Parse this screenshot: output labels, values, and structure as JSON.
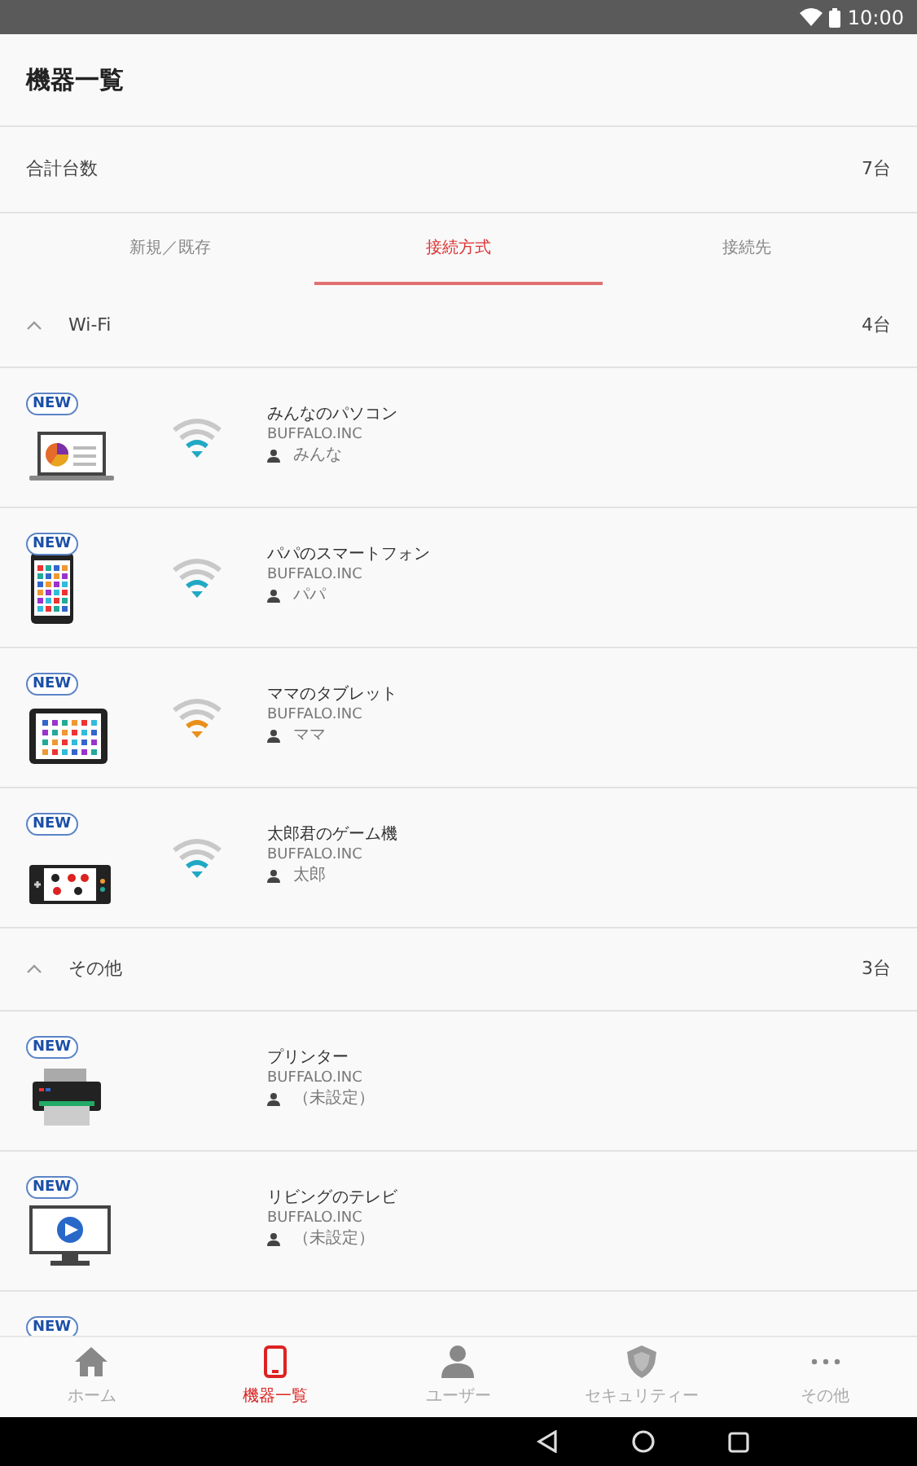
{
  "status_bar": {
    "time": "10:00"
  },
  "header": {
    "title": "機器一覧"
  },
  "total": {
    "label": "合計台数",
    "value": "7台"
  },
  "tabs": [
    {
      "label": "新規／既存",
      "selected": false
    },
    {
      "label": "接続方式",
      "selected": true
    },
    {
      "label": "接続先",
      "selected": false
    }
  ],
  "sections": [
    {
      "title": "Wi-Fi",
      "count": "4台",
      "expanded": true,
      "devices": [
        {
          "kind": "laptop",
          "badge": "NEW",
          "signal": {
            "color": "#21a8c4"
          },
          "name": "みんなのパソコン",
          "maker": "BUFFALO.INC",
          "user": "みんな"
        },
        {
          "kind": "phone",
          "badge": "NEW",
          "signal": {
            "color": "#21a8c4"
          },
          "name": "パパのスマートフォン",
          "maker": "BUFFALO.INC",
          "user": "パパ"
        },
        {
          "kind": "tablet",
          "badge": "NEW",
          "signal": {
            "color": "#e9901a"
          },
          "name": "ママのタブレット",
          "maker": "BUFFALO.INC",
          "user": "ママ"
        },
        {
          "kind": "game",
          "badge": "NEW",
          "signal": {
            "color": "#21a8c4"
          },
          "name": "太郎君のゲーム機",
          "maker": "BUFFALO.INC",
          "user": "太郎"
        }
      ]
    },
    {
      "title": "その他",
      "count": "3台",
      "expanded": true,
      "devices": [
        {
          "kind": "printer",
          "badge": "NEW",
          "name": "プリンター",
          "maker": "BUFFALO.INC",
          "user": "（未設定）"
        },
        {
          "kind": "tv",
          "badge": "NEW",
          "name": "リビングのテレビ",
          "maker": "BUFFALO.INC",
          "user": "（未設定）"
        },
        {
          "badge": "NEW"
        }
      ]
    }
  ],
  "bottom_nav": [
    {
      "kind": "home",
      "label": "ホーム",
      "selected": false
    },
    {
      "kind": "devices",
      "label": "機器一覧",
      "selected": true
    },
    {
      "kind": "user",
      "label": "ユーザー",
      "selected": false
    },
    {
      "kind": "security",
      "label": "セキュリティー",
      "selected": false
    },
    {
      "kind": "more",
      "label": "その他",
      "selected": false
    }
  ]
}
